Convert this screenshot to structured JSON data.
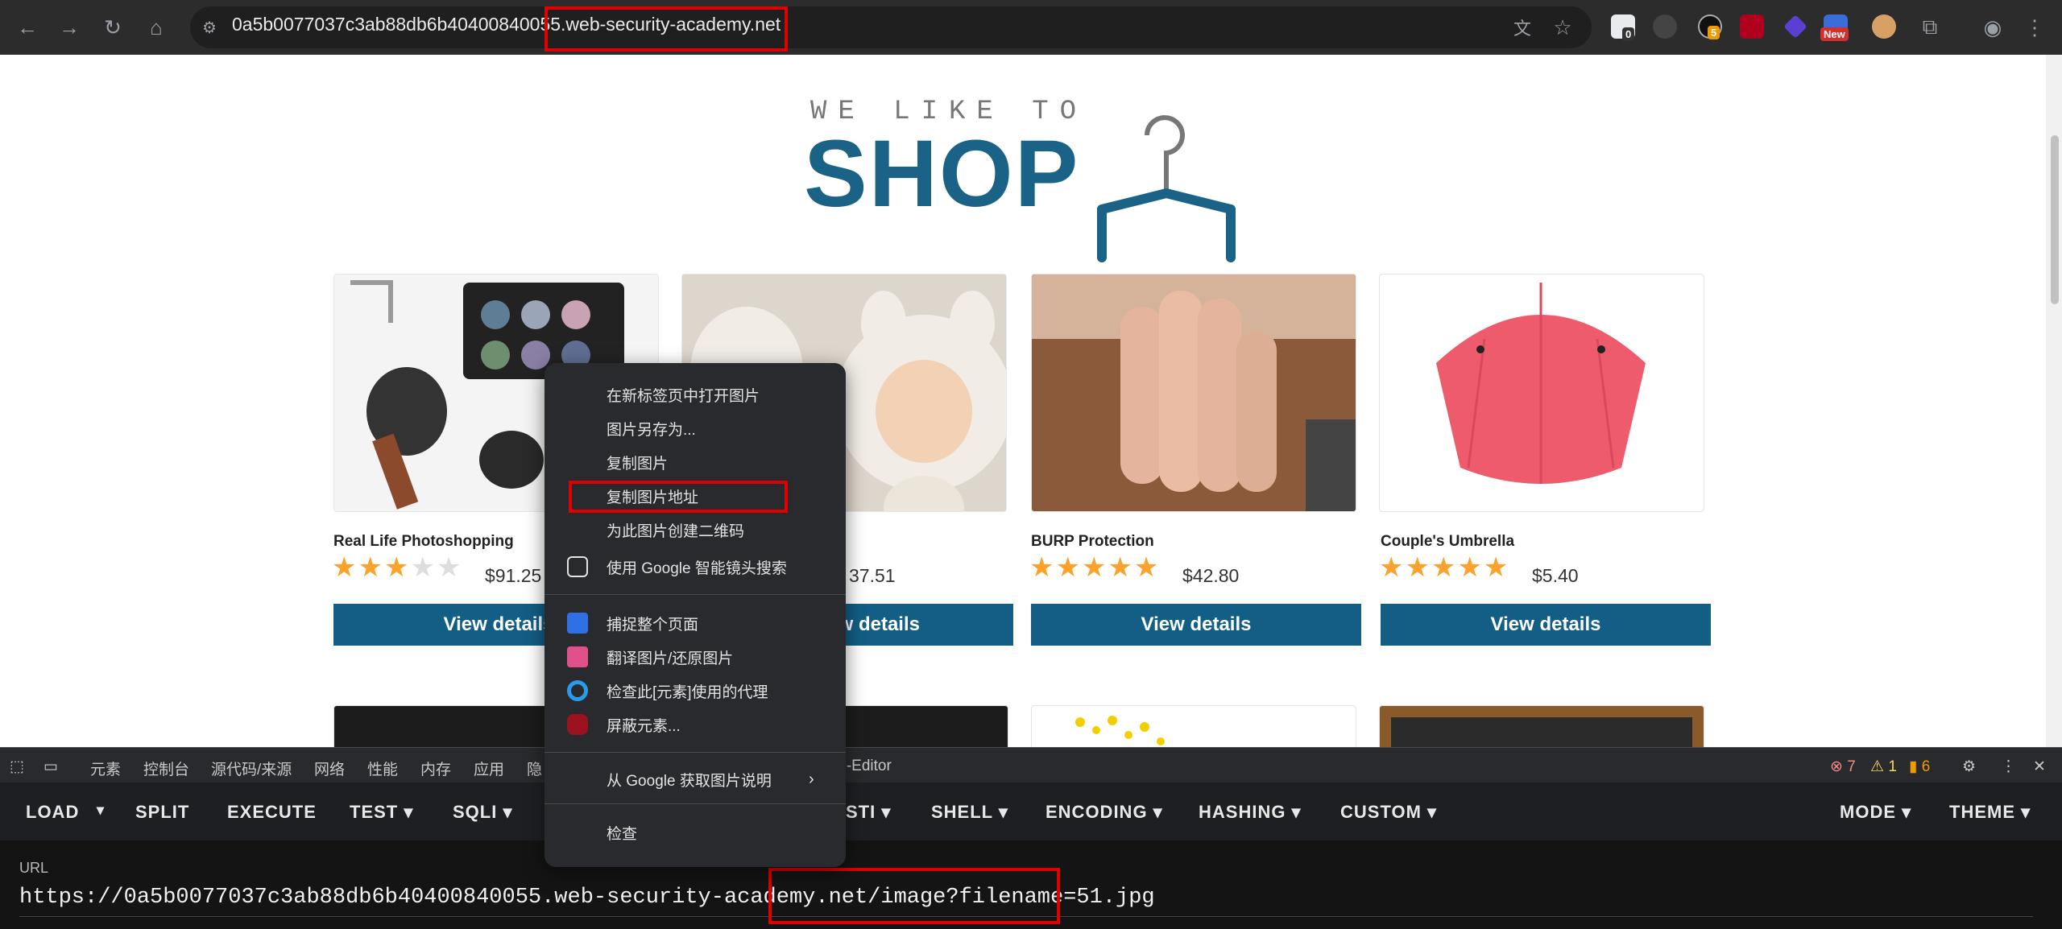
{
  "browser": {
    "url_host_prefix": "0a5b0077037c3ab88db6b40400840055",
    "url_host_suffix": ".web-security-academy.net",
    "extension_badges": {
      "ext3": "5",
      "ext7": "New",
      "ext1": "0"
    }
  },
  "page": {
    "logo_top": "WE LIKE TO",
    "logo_main": "SHOP",
    "products": [
      {
        "title": "Real Life Photoshopping",
        "rating": 3,
        "price": "$91.25",
        "button": "View details"
      },
      {
        "title": "",
        "rating": 0,
        "price": "37.51",
        "button": "View details"
      },
      {
        "title": "BURP Protection",
        "rating": 5,
        "price": "$42.80",
        "button": "View details"
      },
      {
        "title": "Couple's Umbrella",
        "rating": 5,
        "price": "$5.40",
        "button": "View details"
      }
    ]
  },
  "devtools": {
    "tabs": [
      "元素",
      "控制台",
      "源代码/来源",
      "网络",
      "性能",
      "内存",
      "应用",
      "隐",
      "okie-Editor"
    ],
    "status": {
      "errors": "7",
      "warnings": "1",
      "issues": "6"
    }
  },
  "hackbar": {
    "buttons": [
      "LOAD",
      "SPLIT",
      "EXECUTE",
      "TEST ▾",
      "SQLI ▾",
      "STI ▾",
      "SHELL ▾",
      "ENCODING ▾",
      "HASHING ▾",
      "CUSTOM ▾",
      "MODE ▾",
      "THEME ▾"
    ],
    "url_label": "URL",
    "url_value": "https://0a5b0077037c3ab88db6b40400840055.web-security-academy.net/image?filename=51.jpg"
  },
  "context_menu": {
    "items": [
      "在新标签页中打开图片",
      "图片另存为...",
      "复制图片",
      "复制图片地址",
      "为此图片创建二维码",
      "使用 Google 智能镜头搜索",
      "捕捉整个页面",
      "翻译图片/还原图片",
      "检查此[元素]使用的代理",
      "屏蔽元素...",
      "从 Google 获取图片说明",
      "检查"
    ]
  },
  "colors": {
    "brand_blue": "#135e85",
    "highlight_red": "#e00000",
    "star_gold": "#fca12a"
  }
}
